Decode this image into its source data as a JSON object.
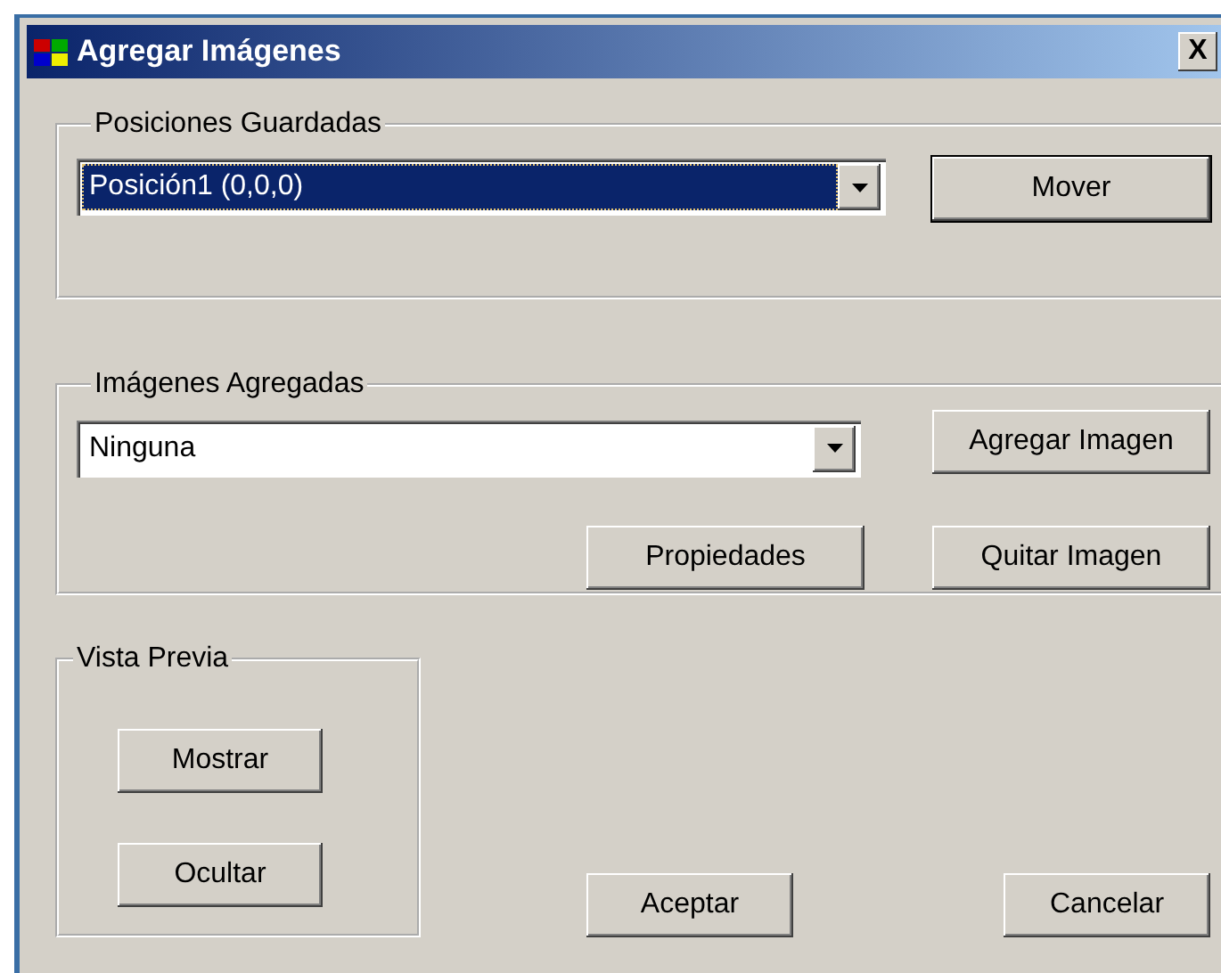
{
  "window": {
    "title": "Agregar Imágenes",
    "close": "X"
  },
  "saved_positions": {
    "legend": "Posiciones Guardadas",
    "combo": {
      "value": "Posición1 (0,0,0)",
      "highlighted": true
    },
    "buttons": [
      {
        "label": "Mover",
        "default": true
      }
    ]
  },
  "added_images": {
    "legend": "Imágenes Agregadas",
    "combo": {
      "value": "Ninguna",
      "highlighted": false
    },
    "buttons": [
      {
        "label": "Agregar Imagen",
        "default": false
      },
      {
        "label": "Propiedades",
        "default": false
      },
      {
        "label": "Quitar Imagen",
        "default": false
      }
    ]
  },
  "preview": {
    "legend": "Vista Previa",
    "buttons": [
      {
        "label": "Mostrar",
        "default": false
      },
      {
        "label": "Ocultar",
        "default": false
      }
    ]
  },
  "footer_buttons": [
    {
      "label": "Aceptar",
      "default": false
    },
    {
      "label": "Cancelar",
      "default": false
    }
  ]
}
